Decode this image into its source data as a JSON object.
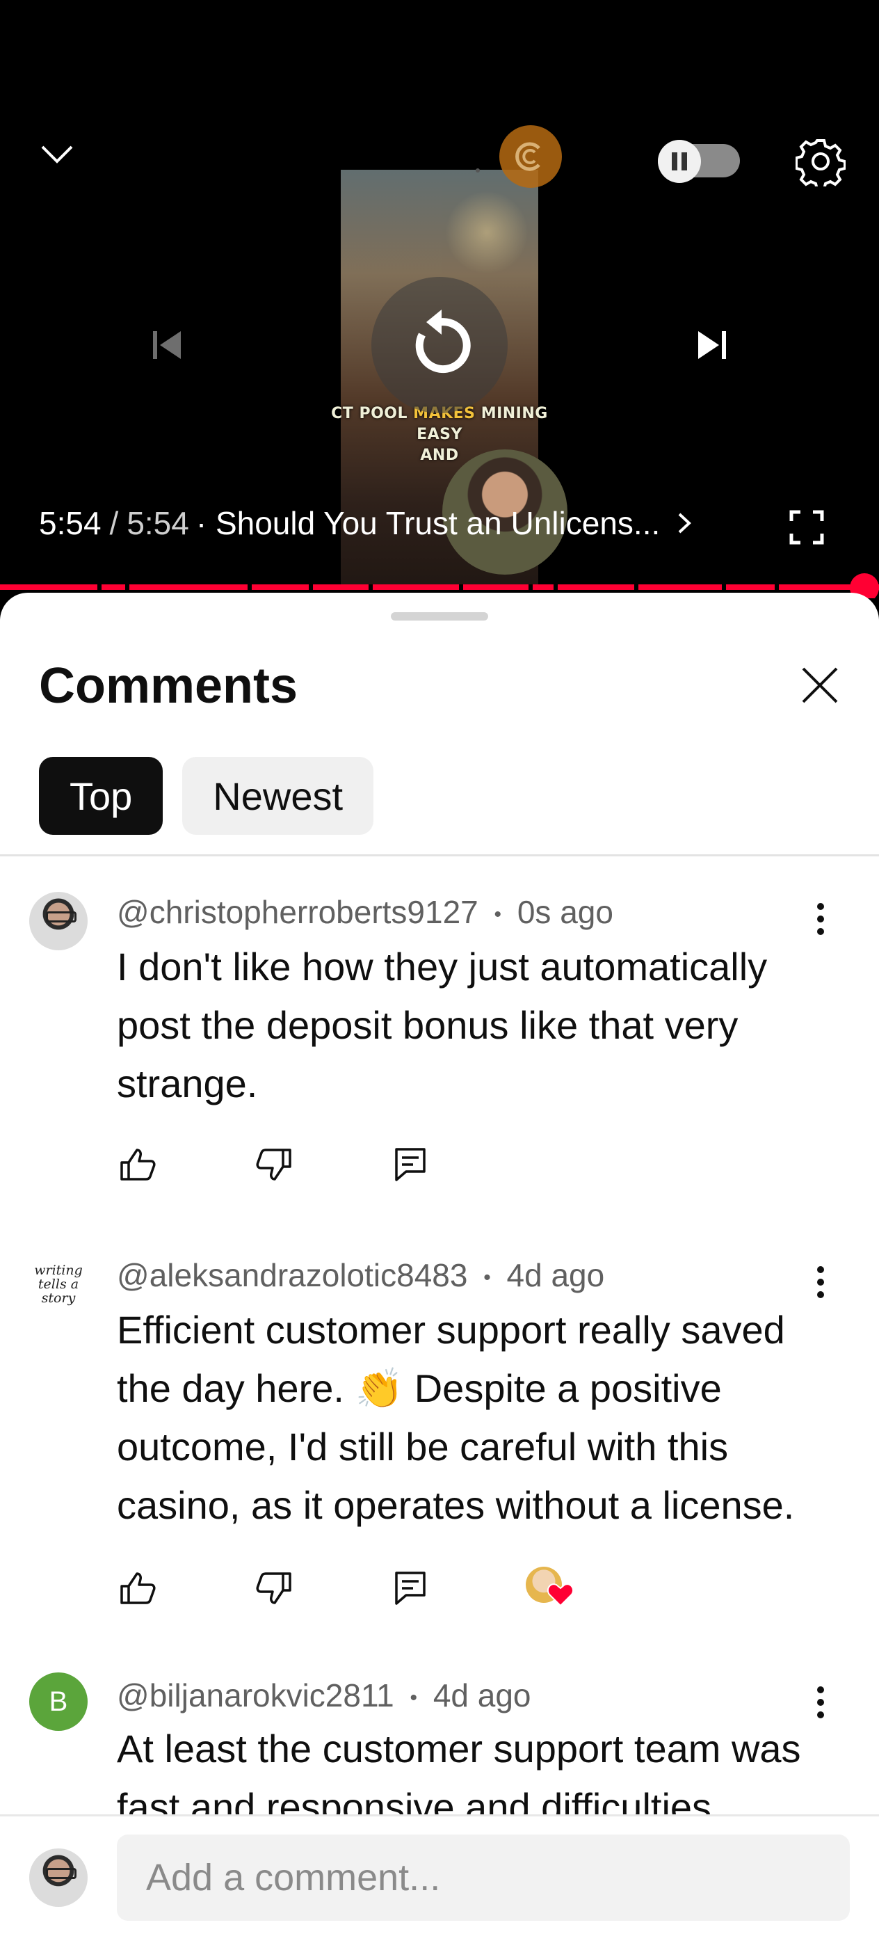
{
  "player": {
    "video_caption_plain": "CT POOL",
    "video_caption_highlight": "MAKES",
    "video_caption_rest": "MINING EASY",
    "video_caption_line2": "AND",
    "current_time": "5:54",
    "separator": "/",
    "duration": "5:54",
    "title": "· Should You Trust an Unlicens...",
    "progress_fraction": 1.0,
    "accent_color": "#ff0033",
    "autoplay": "paused"
  },
  "comments_sheet": {
    "title": "Comments",
    "tabs": [
      {
        "label": "Top",
        "active": true
      },
      {
        "label": "Newest",
        "active": false
      }
    ],
    "comments": [
      {
        "author": "@christopherroberts9127",
        "time": "0s ago",
        "text": "I don't like how they just automatically post the deposit bonus like that very strange.",
        "avatar": "photo"
      },
      {
        "author": "@aleksandrazolotic8483",
        "time": "4d ago",
        "text": "Efficient customer support really saved the day here. 👏 Despite a positive outcome, I'd still be careful with this casino, as it operates without a license.",
        "avatar_text": "writing tells a story",
        "creator_heart": true
      },
      {
        "author": "@biljanarokvic2811",
        "time": "4d ago",
        "text": "At least the customer support team was fast and responsive and difficulties",
        "avatar_letter": "B",
        "avatar_color": "#5ba53b"
      }
    ],
    "meta_separator": "•",
    "add_comment_placeholder": "Add a comment..."
  },
  "icons": [
    "chevron-down-icon",
    "pause-icon",
    "gear-icon",
    "skip-previous-icon",
    "replay-icon",
    "skip-next-icon",
    "chevron-right-icon",
    "fullscreen-icon",
    "close-icon",
    "more-vert-icon",
    "like-icon",
    "dislike-icon",
    "reply-icon",
    "creator-heart-icon"
  ]
}
